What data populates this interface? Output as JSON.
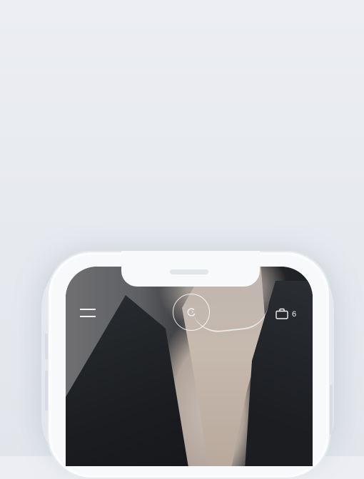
{
  "header": {
    "menu_icon": "hamburger-menu-icon",
    "logo_icon": "circular-logo-icon",
    "cart_icon": "shopping-bag-icon",
    "cart_count": "6"
  },
  "colors": {
    "background": "#e7eaef",
    "phone_frame": "#f8f9fb",
    "icon_color": "#f2f2f2"
  }
}
